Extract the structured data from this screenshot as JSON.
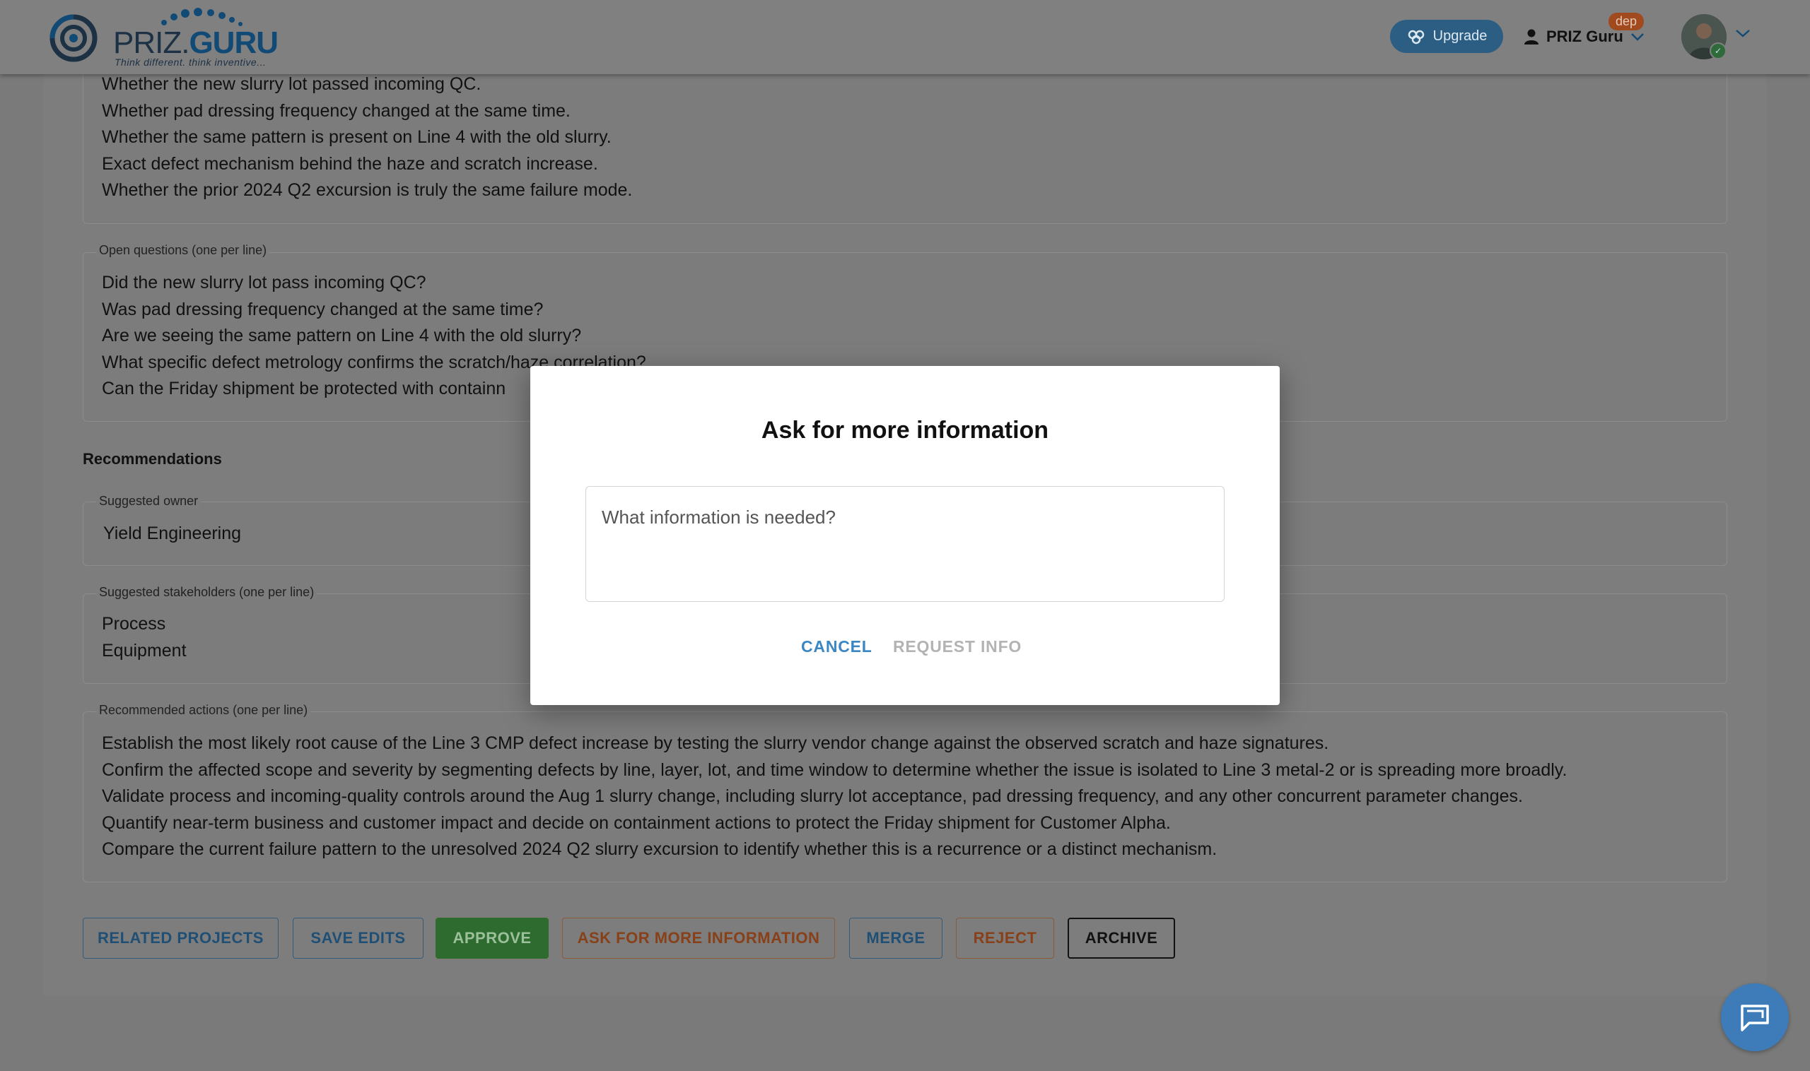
{
  "header": {
    "logo_main": "PRIZ.",
    "logo_guru": "GURU",
    "logo_tagline": "Think different. think inventive...",
    "upgrade_label": "Upgrade",
    "user_name": "PRIZ Guru",
    "badge": "dep"
  },
  "fields": {
    "unknowns": {
      "lines": [
        "Whether the new slurry lot passed incoming QC.",
        "Whether pad dressing frequency changed at the same time.",
        "Whether the same pattern is present on Line 4 with the old slurry.",
        "Exact defect mechanism behind the haze and scratch increase.",
        "Whether the prior 2024 Q2 excursion is truly the same failure mode."
      ]
    },
    "open_questions": {
      "label": "Open questions (one per line)",
      "lines": [
        "Did the new slurry lot pass incoming QC?",
        "Was pad dressing frequency changed at the same time?",
        "Are we seeing the same pattern on Line 4 with the old slurry?",
        "What specific defect metrology confirms the scratch/haze correlation?",
        "Can the Friday shipment be protected with containn"
      ]
    },
    "recommendations_title": "Recommendations",
    "suggested_owner": {
      "label": "Suggested owner",
      "value": "Yield Engineering"
    },
    "suggested_stakeholders": {
      "label": "Suggested stakeholders (one per line)",
      "lines": [
        "Process",
        "Equipment"
      ]
    },
    "recommended_actions": {
      "label": "Recommended actions (one per line)",
      "lines": [
        "Establish the most likely root cause of the Line 3 CMP defect increase by testing the slurry vendor change against the observed scratch and haze signatures.",
        "Confirm the affected scope and severity by segmenting defects by line, layer, lot, and time window to determine whether the issue is isolated to Line 3 metal-2 or is spreading more broadly.",
        "Validate process and incoming-quality controls around the Aug 1 slurry change, including slurry lot acceptance, pad dressing frequency, and any other concurrent parameter changes.",
        "Quantify near-term business and customer impact and decide on containment actions to protect the Friday shipment for Customer Alpha.",
        "Compare the current failure pattern to the unresolved 2024 Q2 slurry excursion to identify whether this is a recurrence or a distinct mechanism."
      ]
    }
  },
  "actions": {
    "related_projects": "RELATED PROJECTS",
    "save_edits": "SAVE EDITS",
    "approve": "APPROVE",
    "ask_more": "ASK FOR MORE INFORMATION",
    "merge": "MERGE",
    "reject": "REJECT",
    "archive": "ARCHIVE"
  },
  "modal": {
    "title": "Ask for more information",
    "input_placeholder": "What information is needed?",
    "input_value": "",
    "cancel_label": "CANCEL",
    "request_label": "REQUEST INFO"
  },
  "icons": {
    "upgrade": "gem-icon",
    "user": "person-icon",
    "chevron": "chevron-down-icon",
    "chat": "chat-bubble-icon"
  },
  "colors": {
    "overlay": "#7a7a7a",
    "primary_blue": "#3b87c4",
    "approve_green": "#2e6b2e",
    "warning_orange": "#874018",
    "chat_button": "#3d7cb8"
  }
}
